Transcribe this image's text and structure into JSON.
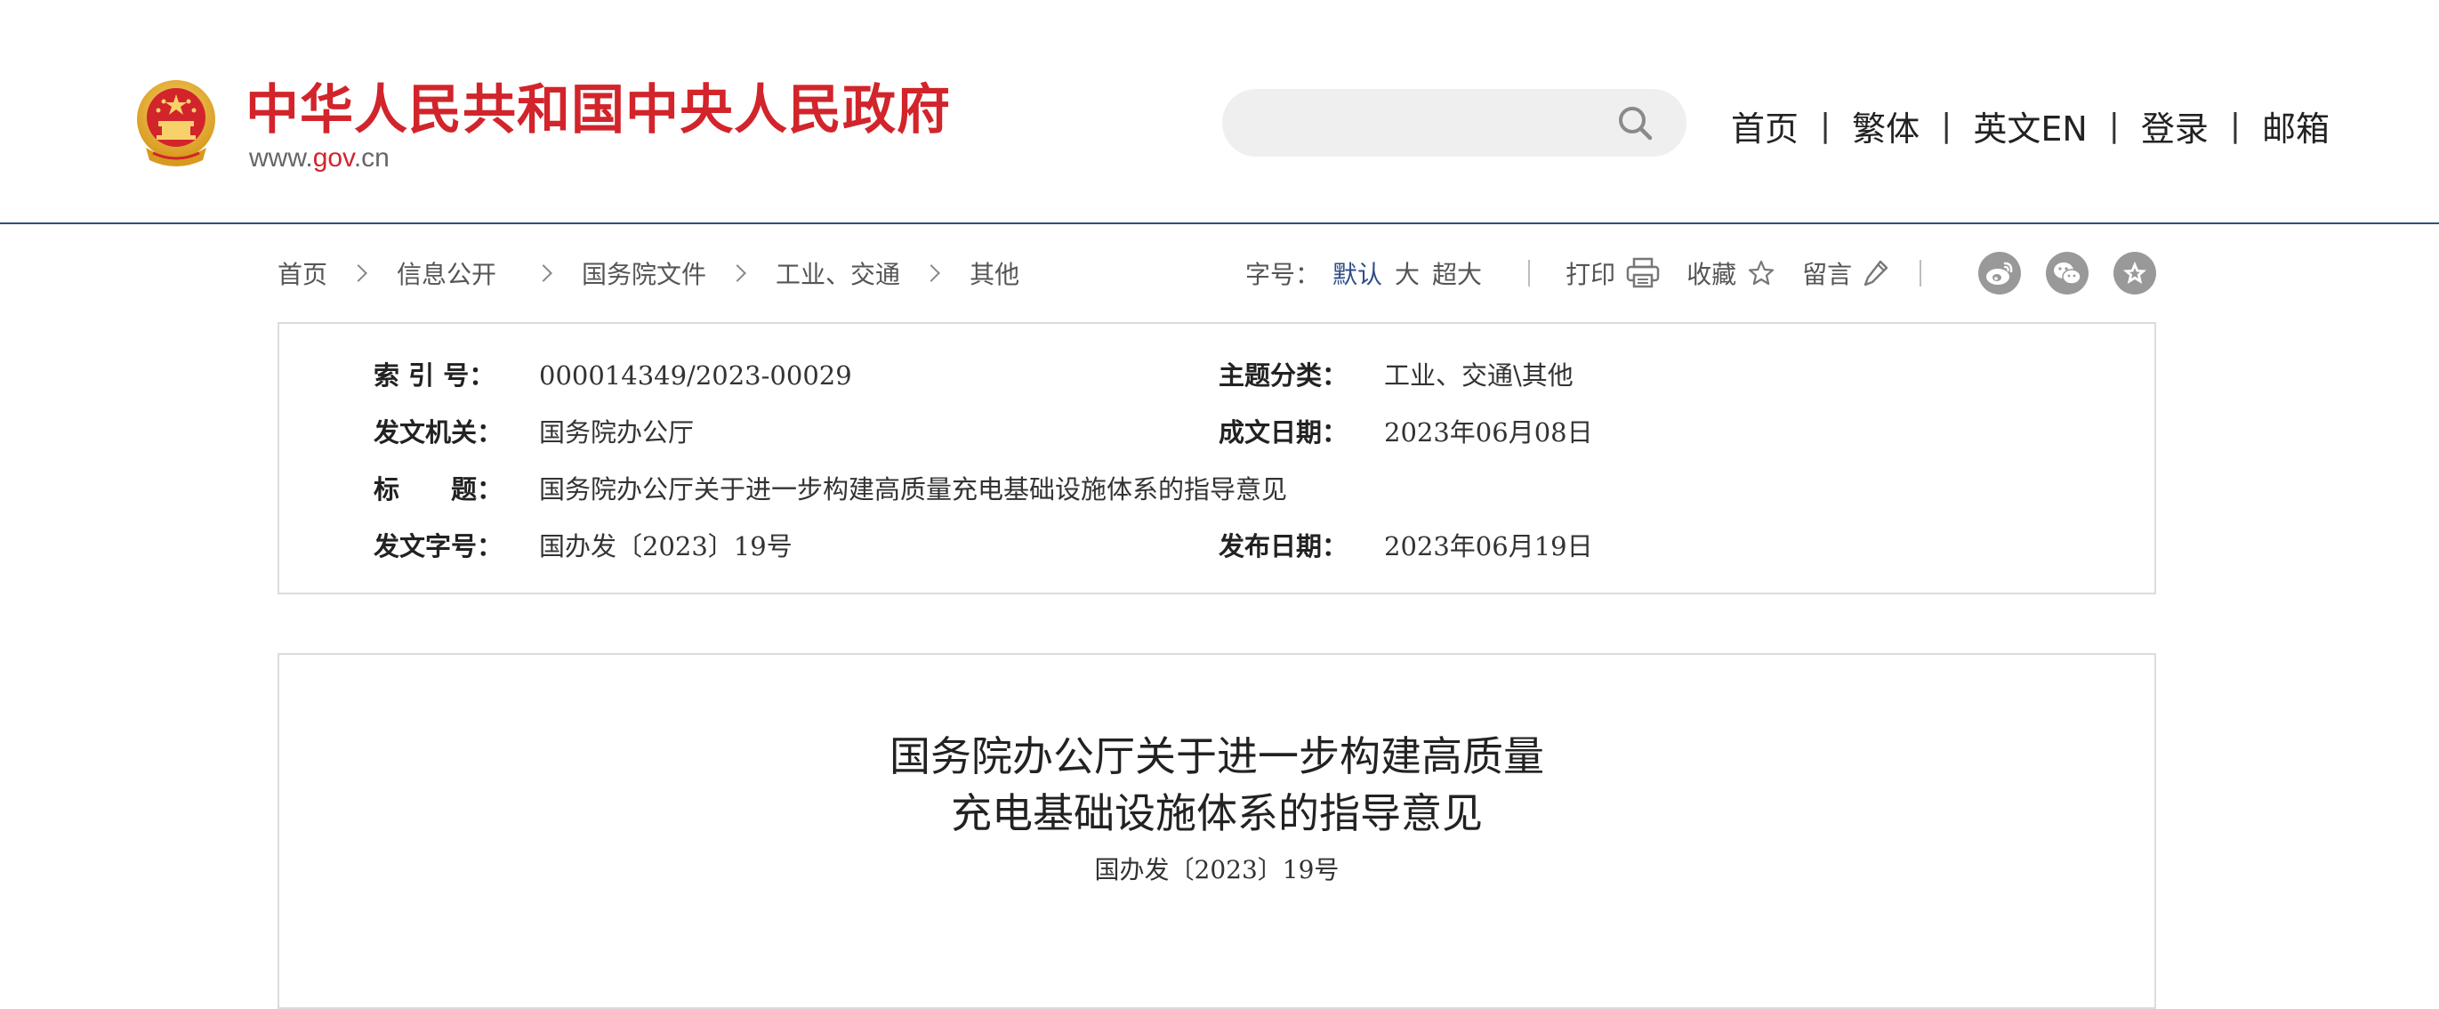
{
  "header": {
    "site_title": "中华人民共和国中央人民政府",
    "url_prefix": "www.",
    "url_gov": "gov",
    "url_suffix": ".cn",
    "search": {
      "value": "",
      "placeholder": ""
    },
    "nav": [
      {
        "label": "首页"
      },
      {
        "label": "繁体"
      },
      {
        "label": "英文EN"
      },
      {
        "label": "登录"
      },
      {
        "label": "邮箱"
      }
    ],
    "nav_separator": "|",
    "brand_red": "#d2242b",
    "rule_blue": "#2f4e86"
  },
  "breadcrumb": [
    {
      "label": "首页"
    },
    {
      "label": "信息公开"
    },
    {
      "label": "国务院文件"
    },
    {
      "label": "工业、交通"
    },
    {
      "label": "其他"
    }
  ],
  "tools": {
    "font_size_label": "字号：",
    "font_size_options": [
      "默认",
      "大",
      "超大"
    ],
    "font_size_selected": "默认",
    "print_label": "打印",
    "favorite_label": "收藏",
    "comment_label": "留言",
    "share_icons": [
      "weibo-icon",
      "wechat-icon",
      "star-icon"
    ]
  },
  "meta": {
    "index_label": "索 引 号：",
    "index_value": "000014349/2023-00029",
    "category_label": "主题分类：",
    "category_value": "工业、交通\\其他",
    "issuer_label": "发文机关：",
    "issuer_value": "国务院办公厅",
    "written_date_label": "成文日期：",
    "written_date_value": "2023年06月08日",
    "title_label": "标　　题：",
    "title_value": "国务院办公厅关于进一步构建高质量充电基础设施体系的指导意见",
    "doc_no_label": "发文字号：",
    "doc_no_value": "国办发〔2023〕19号",
    "publish_date_label": "发布日期：",
    "publish_date_value": "2023年06月19日"
  },
  "article": {
    "title_line1": "国务院办公厅关于进一步构建高质量",
    "title_line2": "充电基础设施体系的指导意见",
    "doc_number": "国办发〔2023〕19号"
  }
}
